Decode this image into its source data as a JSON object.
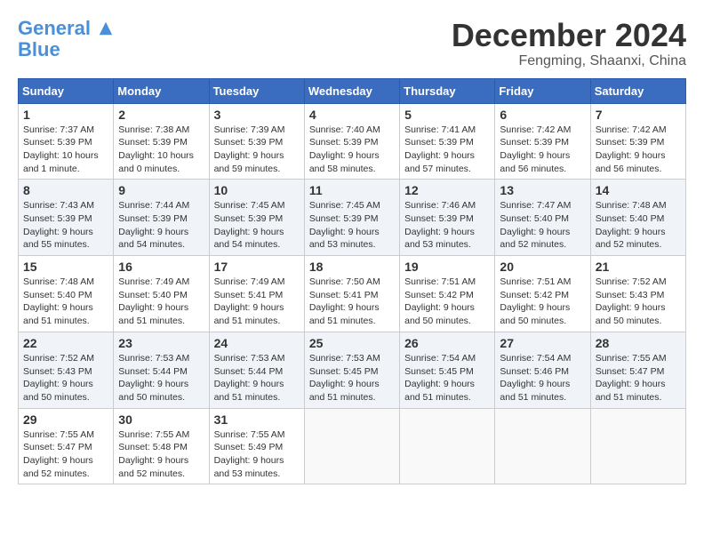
{
  "header": {
    "logo_line1": "General",
    "logo_line2": "Blue",
    "month": "December 2024",
    "location": "Fengming, Shaanxi, China"
  },
  "days_of_week": [
    "Sunday",
    "Monday",
    "Tuesday",
    "Wednesday",
    "Thursday",
    "Friday",
    "Saturday"
  ],
  "weeks": [
    [
      {
        "day": "1",
        "sunrise": "7:37 AM",
        "sunset": "5:39 PM",
        "daylight": "10 hours and 1 minute."
      },
      {
        "day": "2",
        "sunrise": "7:38 AM",
        "sunset": "5:39 PM",
        "daylight": "10 hours and 0 minutes."
      },
      {
        "day": "3",
        "sunrise": "7:39 AM",
        "sunset": "5:39 PM",
        "daylight": "9 hours and 59 minutes."
      },
      {
        "day": "4",
        "sunrise": "7:40 AM",
        "sunset": "5:39 PM",
        "daylight": "9 hours and 58 minutes."
      },
      {
        "day": "5",
        "sunrise": "7:41 AM",
        "sunset": "5:39 PM",
        "daylight": "9 hours and 57 minutes."
      },
      {
        "day": "6",
        "sunrise": "7:42 AM",
        "sunset": "5:39 PM",
        "daylight": "9 hours and 56 minutes."
      },
      {
        "day": "7",
        "sunrise": "7:42 AM",
        "sunset": "5:39 PM",
        "daylight": "9 hours and 56 minutes."
      }
    ],
    [
      {
        "day": "8",
        "sunrise": "7:43 AM",
        "sunset": "5:39 PM",
        "daylight": "9 hours and 55 minutes."
      },
      {
        "day": "9",
        "sunrise": "7:44 AM",
        "sunset": "5:39 PM",
        "daylight": "9 hours and 54 minutes."
      },
      {
        "day": "10",
        "sunrise": "7:45 AM",
        "sunset": "5:39 PM",
        "daylight": "9 hours and 54 minutes."
      },
      {
        "day": "11",
        "sunrise": "7:45 AM",
        "sunset": "5:39 PM",
        "daylight": "9 hours and 53 minutes."
      },
      {
        "day": "12",
        "sunrise": "7:46 AM",
        "sunset": "5:39 PM",
        "daylight": "9 hours and 53 minutes."
      },
      {
        "day": "13",
        "sunrise": "7:47 AM",
        "sunset": "5:40 PM",
        "daylight": "9 hours and 52 minutes."
      },
      {
        "day": "14",
        "sunrise": "7:48 AM",
        "sunset": "5:40 PM",
        "daylight": "9 hours and 52 minutes."
      }
    ],
    [
      {
        "day": "15",
        "sunrise": "7:48 AM",
        "sunset": "5:40 PM",
        "daylight": "9 hours and 51 minutes."
      },
      {
        "day": "16",
        "sunrise": "7:49 AM",
        "sunset": "5:40 PM",
        "daylight": "9 hours and 51 minutes."
      },
      {
        "day": "17",
        "sunrise": "7:49 AM",
        "sunset": "5:41 PM",
        "daylight": "9 hours and 51 minutes."
      },
      {
        "day": "18",
        "sunrise": "7:50 AM",
        "sunset": "5:41 PM",
        "daylight": "9 hours and 51 minutes."
      },
      {
        "day": "19",
        "sunrise": "7:51 AM",
        "sunset": "5:42 PM",
        "daylight": "9 hours and 50 minutes."
      },
      {
        "day": "20",
        "sunrise": "7:51 AM",
        "sunset": "5:42 PM",
        "daylight": "9 hours and 50 minutes."
      },
      {
        "day": "21",
        "sunrise": "7:52 AM",
        "sunset": "5:43 PM",
        "daylight": "9 hours and 50 minutes."
      }
    ],
    [
      {
        "day": "22",
        "sunrise": "7:52 AM",
        "sunset": "5:43 PM",
        "daylight": "9 hours and 50 minutes."
      },
      {
        "day": "23",
        "sunrise": "7:53 AM",
        "sunset": "5:44 PM",
        "daylight": "9 hours and 50 minutes."
      },
      {
        "day": "24",
        "sunrise": "7:53 AM",
        "sunset": "5:44 PM",
        "daylight": "9 hours and 51 minutes."
      },
      {
        "day": "25",
        "sunrise": "7:53 AM",
        "sunset": "5:45 PM",
        "daylight": "9 hours and 51 minutes."
      },
      {
        "day": "26",
        "sunrise": "7:54 AM",
        "sunset": "5:45 PM",
        "daylight": "9 hours and 51 minutes."
      },
      {
        "day": "27",
        "sunrise": "7:54 AM",
        "sunset": "5:46 PM",
        "daylight": "9 hours and 51 minutes."
      },
      {
        "day": "28",
        "sunrise": "7:55 AM",
        "sunset": "5:47 PM",
        "daylight": "9 hours and 51 minutes."
      }
    ],
    [
      {
        "day": "29",
        "sunrise": "7:55 AM",
        "sunset": "5:47 PM",
        "daylight": "9 hours and 52 minutes."
      },
      {
        "day": "30",
        "sunrise": "7:55 AM",
        "sunset": "5:48 PM",
        "daylight": "9 hours and 52 minutes."
      },
      {
        "day": "31",
        "sunrise": "7:55 AM",
        "sunset": "5:49 PM",
        "daylight": "9 hours and 53 minutes."
      },
      null,
      null,
      null,
      null
    ]
  ]
}
